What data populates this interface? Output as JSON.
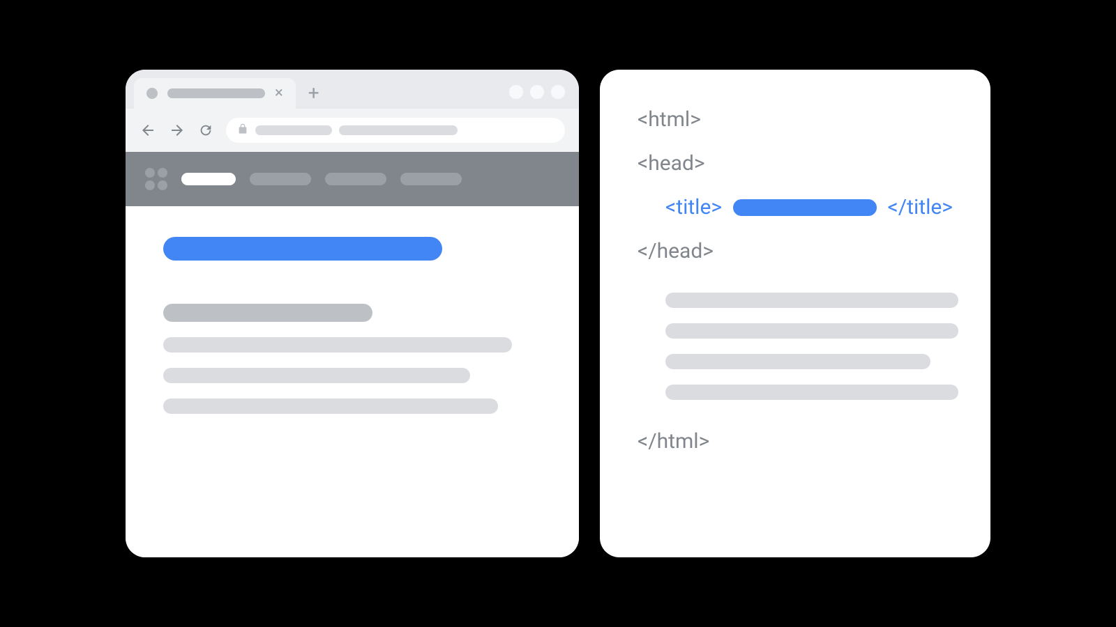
{
  "code": {
    "html_open": "<html>",
    "head_open": "<head>",
    "title_open": "<title>",
    "title_close": "</title>",
    "head_close": "</head>",
    "html_close": "</html>"
  },
  "colors": {
    "accent_blue": "#4285f4",
    "grey_chrome": "#e8eaed",
    "grey_toolbar": "#f1f3f4",
    "grey_header": "#80868b",
    "grey_placeholder": "#dadce0",
    "grey_subhead": "#bdc1c6"
  }
}
